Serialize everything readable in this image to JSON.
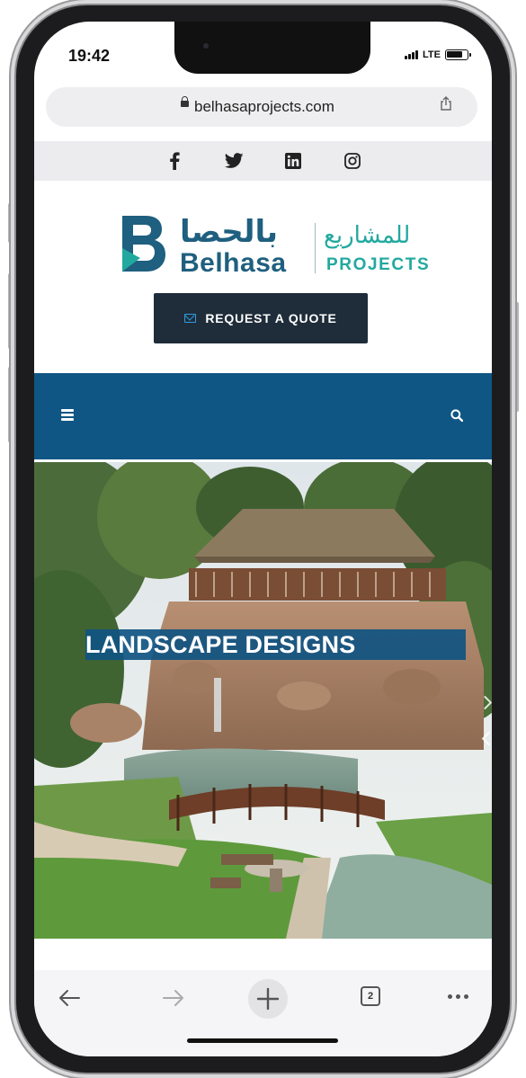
{
  "status_bar": {
    "time": "19:42",
    "network": "LTE"
  },
  "browser": {
    "url": "belhasaprojects.com"
  },
  "social_links": [
    {
      "name": "facebook",
      "glyph": "f"
    },
    {
      "name": "twitter",
      "glyph": "bird"
    },
    {
      "name": "linkedin",
      "glyph": "in"
    },
    {
      "name": "instagram",
      "glyph": "camera"
    }
  ],
  "logo": {
    "arabic_name": "بالحصا",
    "english_name": "Belhasa",
    "arabic_division": "للمشاريع",
    "english_division": "PROJECTS",
    "colors": {
      "navy": "#1f5f7f",
      "teal": "#22a99f"
    }
  },
  "header": {
    "quote_button_label": "REQUEST A QUOTE"
  },
  "nav": {
    "background_color": "#0f5684"
  },
  "hero": {
    "title": "LANDSCAPE DESIGNS"
  },
  "toolbar": {
    "tab_count": "2"
  }
}
